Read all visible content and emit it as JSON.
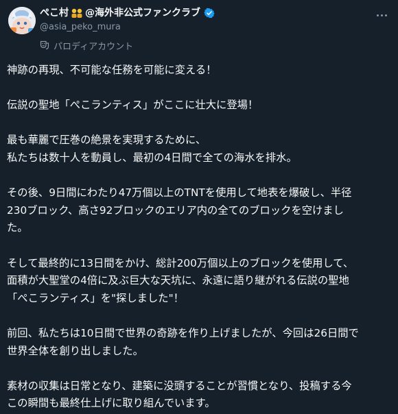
{
  "post": {
    "author": {
      "name_prefix": "ぺこ村",
      "name_suffix": "@海外非公式ファンクラブ",
      "handle": "@asia_peko_mura",
      "parody_label": "パロディアカウント",
      "verified_color": "#1d9bf0"
    },
    "paragraphs": [
      {
        "lines": [
          "神跡の再現、不可能な任務を可能に変える！"
        ]
      },
      {
        "lines": [
          "伝説の聖地「ぺこランティス」がここに壮大に登場！"
        ]
      },
      {
        "lines": [
          "最も華麗で圧巻の絶景を実現するために、",
          "私たちは数十人を動員し、最初の4日間で全ての海水を排水。"
        ]
      },
      {
        "lines": [
          "その後、9日間にわたり47万個以上のTNTを使用して地表を爆破し、半径",
          "230ブロック、高さ92ブロックのエリア内の全てのブロックを空けまし",
          "た。"
        ]
      },
      {
        "lines": [
          "そして最終的に13日間をかけ、総計200万個以上のブロックを使用して、",
          "面積が大聖堂の4倍に及ぶ巨大な天坑に、永遠に語り継がれる伝説の聖地",
          "「ぺこランティス」を\"探しました\"！"
        ]
      },
      {
        "lines": [
          "前回、私たちは10日間で世界の奇跡を作り上げましたが、今回は26日間で",
          "世界全体を創り出しました。"
        ]
      },
      {
        "lines": [
          "素材の収集は日常となり、建築に没頭することが習慣となり、投稿する今",
          "この瞬間も最終仕上げに取り組んでいます。"
        ]
      }
    ]
  },
  "icons": {
    "avatar": "avatar-image",
    "badge_emoji": "group-emoji-icon",
    "verified": "verified-badge-icon",
    "parody": "theater-mask-icon",
    "more": "more-options-icon"
  },
  "colors": {
    "background": "#15202b",
    "text_primary": "#f7f9f9",
    "text_secondary": "#8b98a5"
  }
}
